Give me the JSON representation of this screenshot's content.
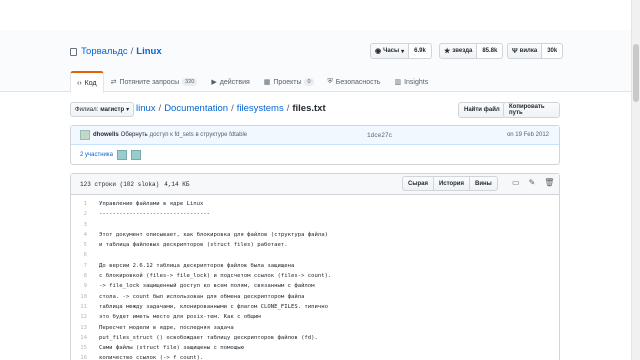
{
  "repo": {
    "owner": "Торвальдс",
    "separator": "/",
    "name": "Linux"
  },
  "actions": [
    {
      "icon": "eye-icon",
      "glyph": "◉",
      "label": "Часы",
      "caret": "▾",
      "count": "6.9k"
    },
    {
      "icon": "star-icon",
      "glyph": "★",
      "label": "звезда",
      "count": "85.8k"
    },
    {
      "icon": "fork-icon",
      "glyph": "Ψ",
      "label": "вилка",
      "count": "30k"
    }
  ],
  "tabs": [
    {
      "name": "tab-code",
      "glyph": "‹›",
      "label": "Код",
      "counter": ""
    },
    {
      "name": "tab-pull-requests",
      "glyph": "⇄",
      "label": "Потяните запросы",
      "counter": "320"
    },
    {
      "name": "tab-actions",
      "glyph": "▶",
      "label": "действия",
      "counter": ""
    },
    {
      "name": "tab-projects",
      "glyph": "▦",
      "label": "Проекты",
      "counter": "0"
    },
    {
      "name": "tab-security",
      "glyph": "⛨",
      "label": "Безопасность",
      "counter": ""
    },
    {
      "name": "tab-insights",
      "glyph": "▥",
      "label": "Insights",
      "counter": ""
    }
  ],
  "branch": {
    "prefix": "Филиал:",
    "value": "магистр",
    "caret": "▾"
  },
  "breadcrumb": {
    "root": "linux",
    "dir1": "Documentation",
    "dir2": "filesystems",
    "file": "files.txt",
    "sep": "/"
  },
  "buttons": {
    "find_file": "Найти файл",
    "copy_path": "Копировать путь"
  },
  "commit": {
    "author": "dhowells",
    "action": "Обернуть",
    "message": "доступ к fd_sets в структуре fdtable",
    "sha": "1dce27c",
    "date": "on 19 Feb 2012",
    "contributors": "2 участника"
  },
  "file": {
    "lines": "123 строки (102 sloka)",
    "size": "4,14 КБ",
    "raw": "Сырая",
    "history": "История",
    "blame": "Вины",
    "code": [
      "Управление файлами в ядре Linux",
      "---------------------------------",
      "",
      "Этот документ описывает, как блокировка для файлов (структура файла)",
      "и таблица файловых дескрипторов (struct files) работает.",
      "",
      "До версии 2.6.12 таблица дескрипторов файлов была защищена",
      "с блокировкой (files-> file_lock) и подсчетом ссылок (files-> count).",
      "-> file_lock защищенный доступ ко всем полям, связанным с файлом",
      "стола. -> count был использован для обмена дескриптором файла",
      "таблица между задачами, клонированными с флагом CLONE_FILES. типично",
      "это будет иметь место для posix-тем. Как с общим",
      "Пересчет модели в ядре, последняя задача",
      "put_files_struct () освобождает таблицу дескрипторов файлов (fd).",
      "Сами файлы (struct file) защищены с помощью",
      "количество ссылок (-> f_count)."
    ]
  }
}
